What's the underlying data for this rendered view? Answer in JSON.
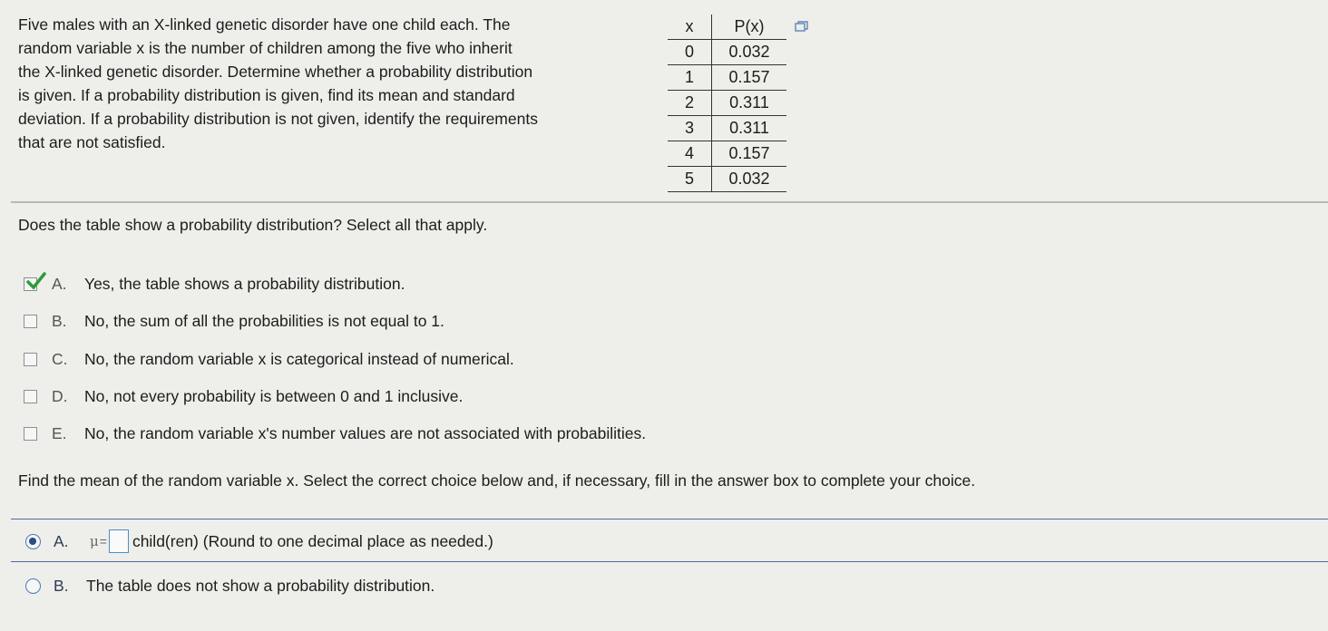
{
  "problem": {
    "lines": [
      "Five males with an X-linked genetic disorder have one child each. The",
      "random variable x is the number of children among the five who inherit",
      "the X-linked genetic disorder. Determine whether a probability distribution",
      "is given. If a probability distribution is given, find its mean and standard",
      "deviation. If a probability distribution is not given, identify the requirements",
      "that are not satisfied."
    ]
  },
  "table": {
    "headers": [
      "x",
      "P(x)"
    ],
    "rows": [
      [
        "0",
        "0.032"
      ],
      [
        "1",
        "0.157"
      ],
      [
        "2",
        "0.311"
      ],
      [
        "3",
        "0.311"
      ],
      [
        "4",
        "0.157"
      ],
      [
        "5",
        "0.032"
      ]
    ],
    "copy_icon": "copy-icon"
  },
  "question1": {
    "prompt": "Does the table show a probability distribution? Select all that apply.",
    "options": [
      {
        "letter": "A.",
        "text": "Yes, the table shows a probability distribution.",
        "checked": true
      },
      {
        "letter": "B.",
        "text": "No, the sum of all the probabilities is not equal to 1.",
        "checked": false
      },
      {
        "letter": "C.",
        "text": "No, the random variable x is categorical instead of numerical.",
        "checked": false
      },
      {
        "letter": "D.",
        "text": "No, not every probability is between 0 and 1 inclusive.",
        "checked": false
      },
      {
        "letter": "E.",
        "text": "No, the random variable x's number values are not associated with probabilities.",
        "checked": false
      }
    ]
  },
  "question2": {
    "prompt": "Find the mean of the random variable x. Select the correct choice below and, if necessary, fill in the answer box to complete your choice.",
    "option_a": {
      "letter": "A.",
      "symbol": "μ",
      "equals": "=",
      "input_value": "",
      "suffix": "child(ren) (Round to one decimal place as needed.)",
      "selected": true
    },
    "option_b": {
      "letter": "B.",
      "text": "The table does not show a probability distribution.",
      "selected": false
    }
  },
  "colors": {
    "background": "#eeeeea",
    "accent": "#4a78b6",
    "check": "#2e9a3a"
  }
}
